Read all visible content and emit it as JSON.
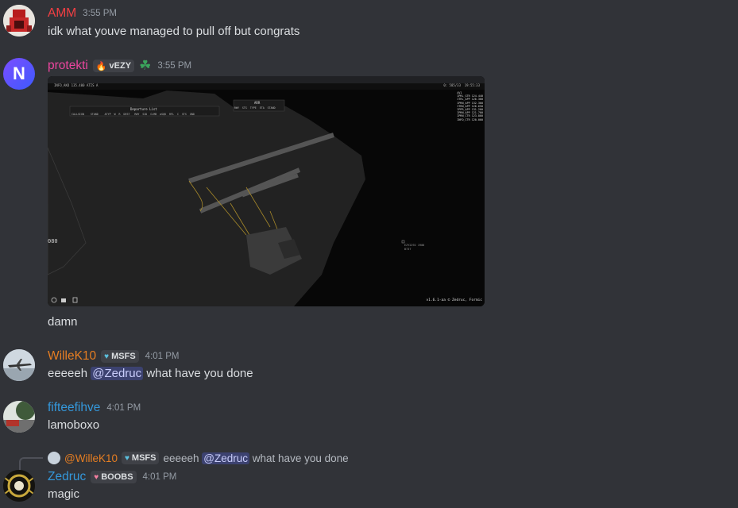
{
  "messages": [
    {
      "user": "AMM",
      "color": "#f23f43",
      "time": "3:55 PM",
      "text": "idk what youve managed to pull off but congrats"
    },
    {
      "user": "protekti",
      "color": "#eb459e",
      "time": "3:55 PM",
      "avatar_letter": "N",
      "tag": "vEZY",
      "image": {
        "top_readout": "INFO_AKO   135.400   ATIS A",
        "clock": "19:55:33",
        "panel1_title": "Departure List",
        "panel1_cols": "CALLSIGN    STAND    ATYP  W  R  DEST   RWY  SID  CLMB  aSQK  RFL  C  STS  GND",
        "panel2_title": "ARR",
        "panel2_cols": "RWY  STS  TYPE  ETA  STAND",
        "freq_list": [
          "AV1",
          "IPRL_GTR 124.440",
          "ITRL_APP 126.300",
          "IPRN_APP 132.300",
          "ITRN_APP 126.650",
          "IPPR_APP 131.200",
          "IPRN_APP 121.700",
          "IPRN_CTR 123.800",
          "INFO_CTR 120.000"
        ],
        "left_label": "080",
        "traffic_label": "EZY2292 1900",
        "traffic_sub": "B737",
        "version": "v1.6.1-aa © Zedruc, Formic",
        "status_right": "0: 585/33"
      },
      "text": "damn"
    },
    {
      "user": "WilleK10",
      "color": "#e67e22",
      "time": "4:01 PM",
      "tag": "MSFS",
      "pre": "eeeeeh ",
      "mention": "@Zedruc",
      "post": " what have you done"
    },
    {
      "user": "fifteefihve",
      "color": "#3498db",
      "time": "4:01 PM",
      "text": "lamoboxo"
    },
    {
      "user": "Zedruc",
      "color": "#3498db",
      "time": "4:01 PM",
      "tag": "BOOBS",
      "text": "magic",
      "reply": {
        "user": "@WilleK10",
        "tag": "MSFS",
        "pre": "eeeeeh ",
        "mention": "@Zedruc",
        "post": " what have you done"
      }
    }
  ]
}
